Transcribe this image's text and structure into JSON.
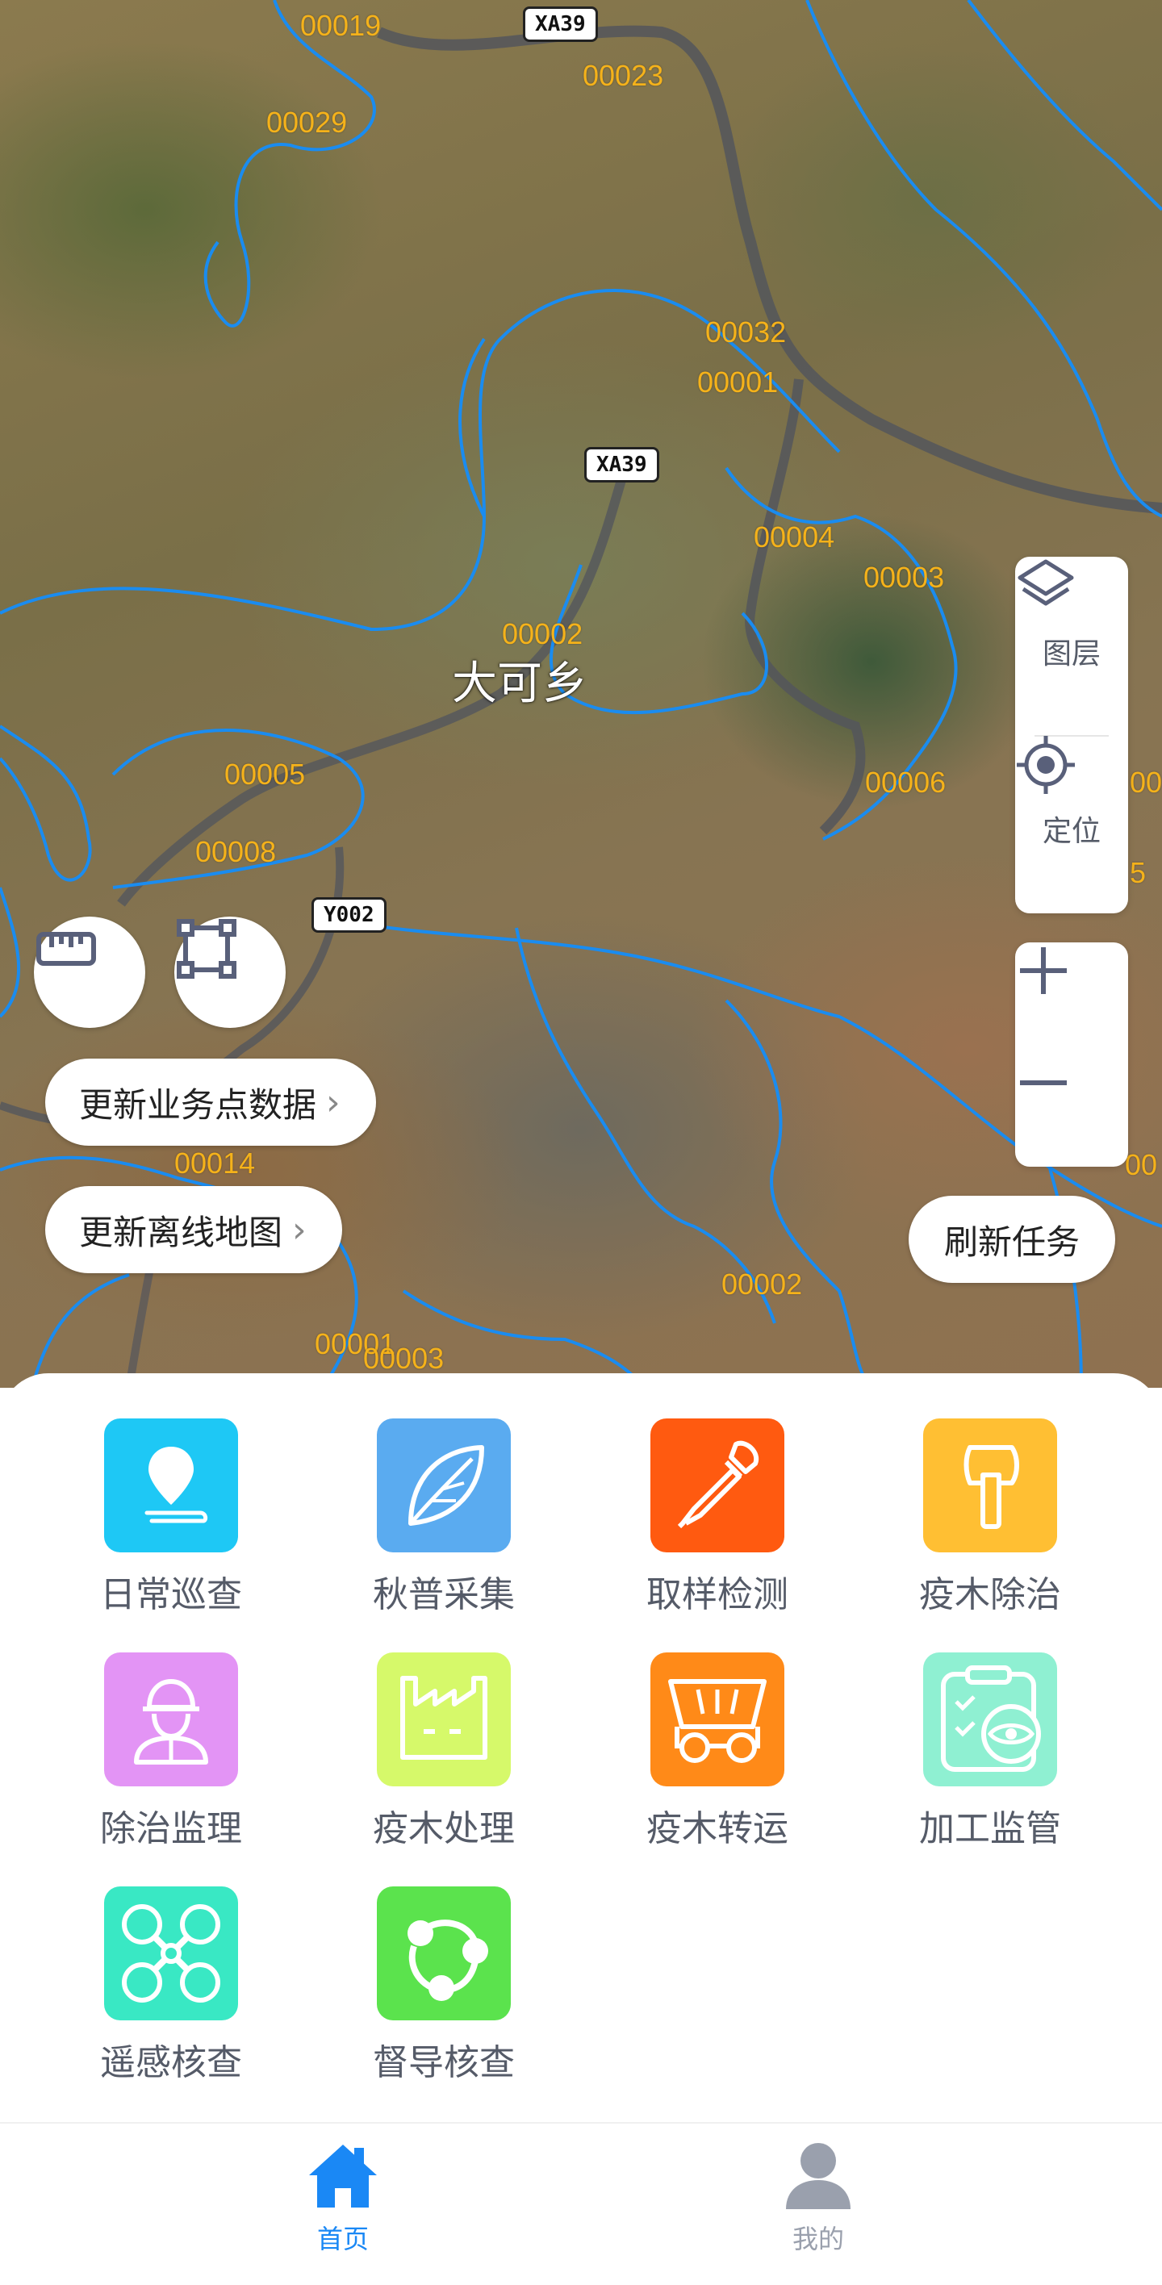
{
  "map": {
    "town_name": "大可乡",
    "roads": [
      "XA39",
      "XA39",
      "Y002"
    ],
    "poi_labels": [
      "00019",
      "00023",
      "00029",
      "00032",
      "00001",
      "00004",
      "00003",
      "00002",
      "00005",
      "00006",
      "00008",
      "00014",
      "00002",
      "00001",
      "00003"
    ],
    "edge_labels": [
      "00",
      "5",
      "00"
    ]
  },
  "side_panel": {
    "layers_label": "图层",
    "locate_label": "定位",
    "layers_icon": "layers-icon",
    "locate_icon": "locate-icon",
    "zoom_in_icon": "plus-icon",
    "zoom_out_icon": "minus-icon"
  },
  "tools": {
    "ruler_icon": "ruler-icon",
    "area_icon": "area-select-icon"
  },
  "actions": {
    "update_business": "更新业务点数据",
    "update_offline_map": "更新离线地图",
    "refresh_task": "刷新任务"
  },
  "functions": [
    {
      "label": "日常巡查",
      "icon": "location-pin-icon",
      "color": "#1ec8f5"
    },
    {
      "label": "秋普采集",
      "icon": "leaf-icon",
      "color": "#5aabf0"
    },
    {
      "label": "取样检测",
      "icon": "dropper-icon",
      "color": "#ff5a10"
    },
    {
      "label": "疫木除治",
      "icon": "axe-icon",
      "color": "#ffbf33"
    },
    {
      "label": "除治监理",
      "icon": "worker-icon",
      "color": "#e394f5"
    },
    {
      "label": "疫木处理",
      "icon": "factory-icon",
      "color": "#d6f96a"
    },
    {
      "label": "疫木转运",
      "icon": "truck-icon",
      "color": "#ff8a18"
    },
    {
      "label": "加工监管",
      "icon": "clipboard-eye-icon",
      "color": "#8ff0d2"
    },
    {
      "label": "遥感核查",
      "icon": "drone-icon",
      "color": "#39e8c4"
    },
    {
      "label": "督导核查",
      "icon": "share-icon",
      "color": "#5be34d"
    }
  ],
  "bottom_nav": {
    "home_label": "首页",
    "mine_label": "我的",
    "home_color": "#1a88f5",
    "mine_color": "#9aa0ad"
  }
}
